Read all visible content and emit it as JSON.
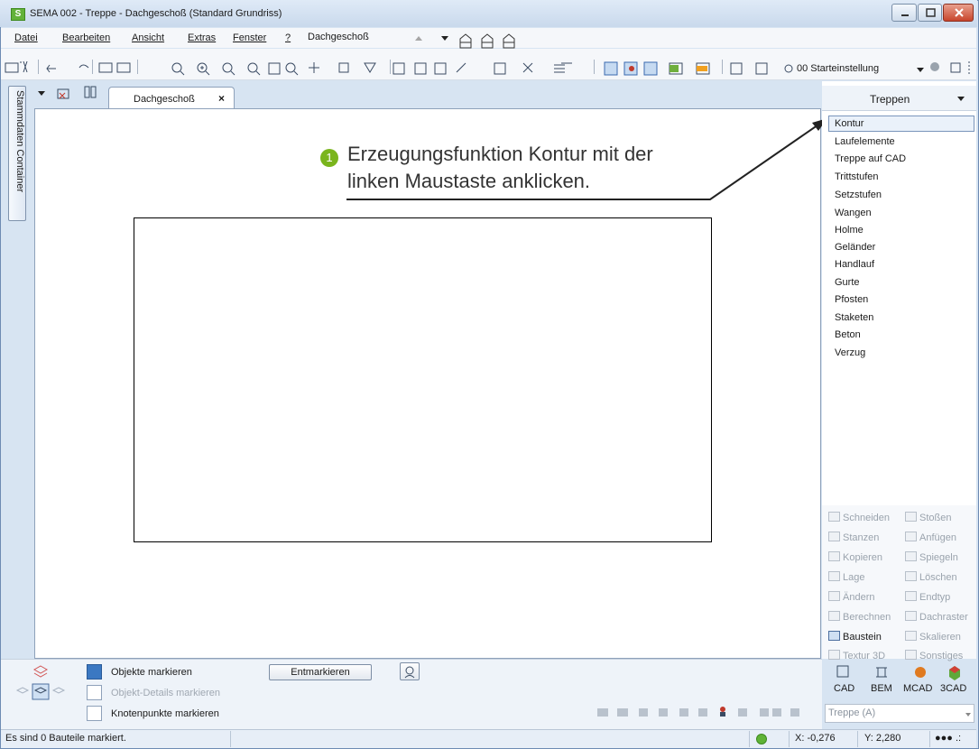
{
  "window": {
    "title": "SEMA  002 - Treppe  - Dachgeschoß (Standard Grundriss)",
    "app_badge": "S"
  },
  "menu": {
    "items": [
      "Datei",
      "Bearbeiten",
      "Ansicht",
      "Extras",
      "Fenster",
      "?"
    ],
    "floor": "Dachgeschoß"
  },
  "toolbar": {
    "preset": "00 Starteinstellung"
  },
  "sidebar_left": {
    "tab_label": "Stammdaten Container"
  },
  "document": {
    "tab_label": "Dachgeschoß",
    "tab_close": "×"
  },
  "annotation": {
    "number": "1",
    "line1": "Erzeugungsfunktion Kontur  mit der",
    "line2": "linken Maustaste anklicken."
  },
  "right_panel": {
    "title": "Treppen",
    "items": [
      "Kontur",
      "Laufelemente",
      "Treppe auf CAD",
      "Trittstufen",
      "Setzstufen",
      "Wangen",
      "Holme",
      "Geländer",
      "Handlauf",
      "Gurte",
      "Pfosten",
      "Staketen",
      "Beton",
      "Verzug"
    ],
    "selected": "Kontur",
    "tools": [
      [
        "Schneiden",
        "Stoßen"
      ],
      [
        "Stanzen",
        "Anfügen"
      ],
      [
        "Kopieren",
        "Spiegeln"
      ],
      [
        "Lage",
        "Löschen"
      ],
      [
        "Ändern",
        "Endtyp"
      ],
      [
        "Berechnen",
        "Dachraster"
      ],
      [
        "Baustein",
        "Skalieren"
      ],
      [
        "Textur 3D",
        "Sonstiges"
      ]
    ],
    "modes": [
      "CAD",
      "BEM",
      "MCAD",
      "3CAD"
    ],
    "combo_value": "Treppe (A)"
  },
  "bottom": {
    "mark_objects": "Objekte markieren",
    "mark_details": "Objekt-Details markieren",
    "mark_nodes": "Knotenpunkte markieren",
    "unmark_button": "Entmarkieren"
  },
  "status": {
    "message": "Es sind 0 Bauteile markiert.",
    "x": "X: -0,276",
    "y": "Y: 2,280",
    "dots": "●●● .:"
  },
  "colors": {
    "accent": "#7ab51d",
    "frame": "#d7e4f2",
    "selection": "#3b78c2"
  }
}
